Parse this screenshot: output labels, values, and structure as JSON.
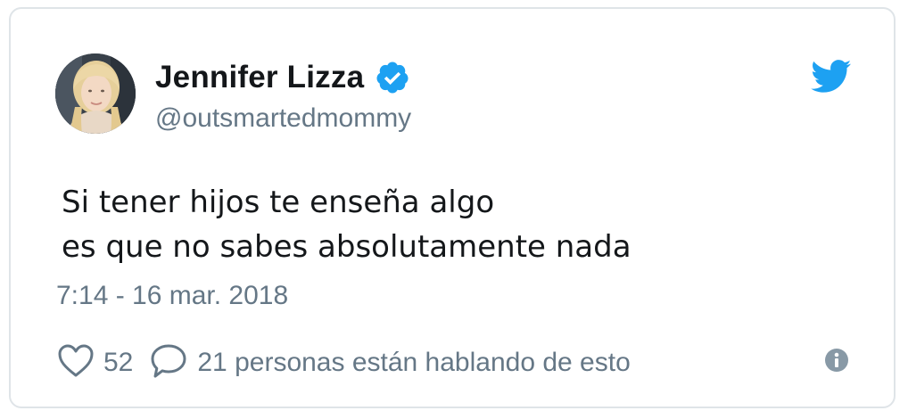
{
  "author": {
    "display_name": "Jennifer Lizza",
    "handle": "@outsmartedmommy",
    "verified": true
  },
  "tweet": {
    "lines": [
      "Si tener hijos te enseña algo",
      "es que no sabes absolutamente nada"
    ],
    "timestamp": "7:14 - 16 mar. 2018"
  },
  "engagement": {
    "likes": "52",
    "conversation": "21 personas están hablando de esto"
  },
  "icons": {
    "brand": "twitter-bird-icon",
    "verified": "verified-badge-icon",
    "like": "heart-icon",
    "reply": "speech-bubble-icon",
    "info": "info-icon"
  },
  "colors": {
    "brand_blue": "#1da1f2",
    "text_primary": "#14171a",
    "text_secondary": "#657786",
    "border": "#dfe4e8"
  }
}
